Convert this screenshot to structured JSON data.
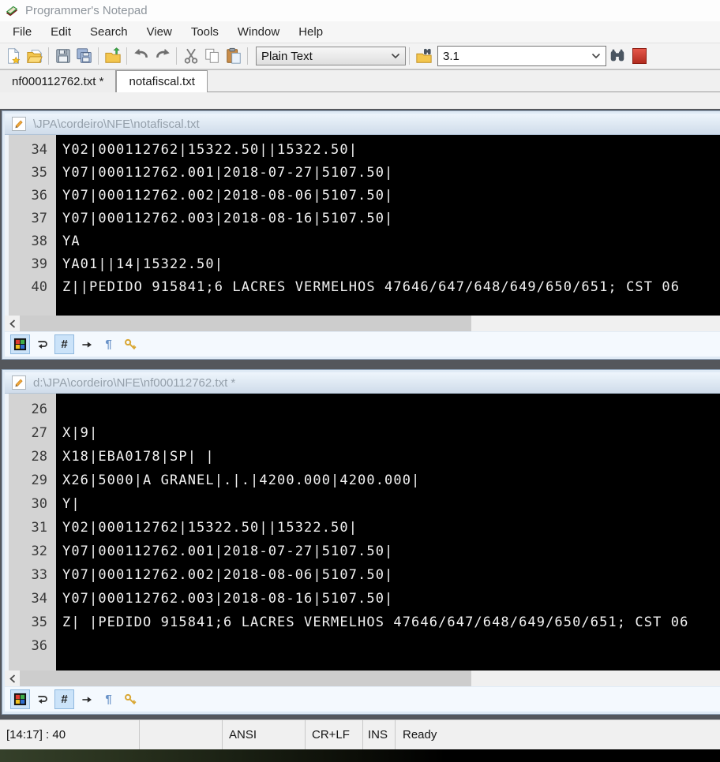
{
  "window": {
    "title": "Programmer's Notepad"
  },
  "menu": {
    "items": [
      "File",
      "Edit",
      "Search",
      "View",
      "Tools",
      "Window",
      "Help"
    ]
  },
  "toolbar": {
    "buttons": [
      "new-document",
      "open-file",
      "save",
      "save-all",
      "open-project",
      "undo",
      "redo",
      "cut",
      "copy",
      "paste",
      "find-in-files",
      "find"
    ],
    "scheme_value": "Plain Text",
    "find_value": "3.1"
  },
  "tabs": [
    {
      "label": "nf000112762.txt *",
      "active": false
    },
    {
      "label": "notafiscal.txt",
      "active": true
    }
  ],
  "pane_toolbar": {
    "buttons": [
      "scheme-colors",
      "word-wrap",
      "line-numbers",
      "whitespace-arrows",
      "paragraph-marks",
      "write-protect"
    ],
    "pressed": [
      "scheme-colors",
      "line-numbers"
    ]
  },
  "panes": [
    {
      "title": "\\JPA\\cordeiro\\NFE\\notafiscal.txt",
      "lines": [
        {
          "num": 34,
          "text": "Y02|000112762|15322.50||15322.50|"
        },
        {
          "num": 35,
          "text": "Y07|000112762.001|2018-07-27|5107.50|"
        },
        {
          "num": 36,
          "text": "Y07|000112762.002|2018-08-06|5107.50|"
        },
        {
          "num": 37,
          "text": "Y07|000112762.003|2018-08-16|5107.50|"
        },
        {
          "num": 38,
          "text": "YA"
        },
        {
          "num": 39,
          "text": "YA01||14|15322.50|"
        },
        {
          "num": 40,
          "text": "Z||PEDIDO 915841;6 LACRES VERMELHOS 47646/647/648/649/650/651; CST 06"
        }
      ]
    },
    {
      "title": "d:\\JPA\\cordeiro\\NFE\\nf000112762.txt *",
      "lines": [
        {
          "num": 26,
          "text": ""
        },
        {
          "num": 27,
          "text": "X|9|"
        },
        {
          "num": 28,
          "text": "X18|EBA0178|SP| |"
        },
        {
          "num": 29,
          "text": "X26|5000|A GRANEL|.|.|4200.000|4200.000|"
        },
        {
          "num": 30,
          "text": "Y|"
        },
        {
          "num": 31,
          "text": "Y02|000112762|15322.50||15322.50|"
        },
        {
          "num": 32,
          "text": "Y07|000112762.001|2018-07-27|5107.50|"
        },
        {
          "num": 33,
          "text": "Y07|000112762.002|2018-08-06|5107.50|"
        },
        {
          "num": 34,
          "text": "Y07|000112762.003|2018-08-16|5107.50|"
        },
        {
          "num": 35,
          "text": "Z| |PEDIDO 915841;6 LACRES VERMELHOS 47646/647/648/649/650/651; CST 06"
        },
        {
          "num": 36,
          "text": ""
        }
      ]
    }
  ],
  "statusbar": {
    "position": "[14:17] : 40",
    "encoding": "ANSI",
    "line_ending": "CR+LF",
    "mode": "INS",
    "message": "Ready"
  },
  "colors": {
    "editor_bg": "#000000",
    "editor_text": "#f2f2f2",
    "gutter_bg": "#d3d3d3",
    "caption_text": "#95a0ab",
    "mdi_bg": "#54575c"
  }
}
